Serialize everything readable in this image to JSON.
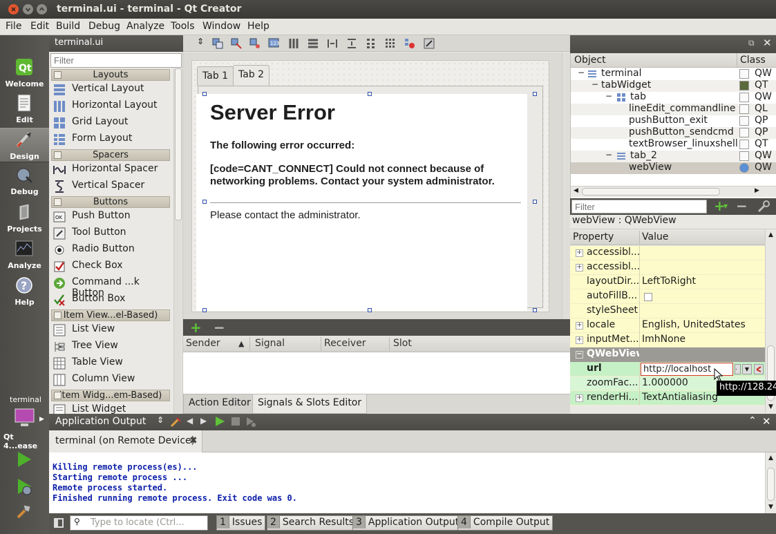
{
  "window": {
    "title": "terminal.ui - terminal - Qt Creator"
  },
  "menu": [
    "File",
    "Edit",
    "Build",
    "Debug",
    "Analyze",
    "Tools",
    "Window",
    "Help"
  ],
  "modes": [
    {
      "label": "Welcome",
      "icon": "qt-logo-icon"
    },
    {
      "label": "Edit",
      "icon": "edit-document-icon"
    },
    {
      "label": "Design",
      "icon": "design-brush-icon"
    },
    {
      "label": "Debug",
      "icon": "debug-bug-icon"
    },
    {
      "label": "Projects",
      "icon": "projects-folder-icon"
    },
    {
      "label": "Analyze",
      "icon": "analyze-chart-icon"
    },
    {
      "label": "Help",
      "icon": "help-question-icon"
    }
  ],
  "target": {
    "project": "terminal",
    "kit": "Qt 4...ease"
  },
  "widgetbox": {
    "file": "terminal.ui",
    "filter_placeholder": "Filter",
    "categories": {
      "layouts": "Layouts",
      "spacers": "Spacers",
      "buttons": "Buttons",
      "item_views": "Item View...el-Based)",
      "item_widgets": "Item Widg...em-Based)"
    },
    "layouts": [
      "Vertical Layout",
      "Horizontal Layout",
      "Grid Layout",
      "Form Layout"
    ],
    "spacers": [
      "Horizontal Spacer",
      "Vertical Spacer"
    ],
    "buttons": [
      "Push Button",
      "Tool Button",
      "Radio Button",
      "Check Box",
      "Command ...k Button",
      "Button Box"
    ],
    "item_views": [
      "List View",
      "Tree View",
      "Table View",
      "Column View"
    ],
    "item_widgets": [
      "List Widget"
    ]
  },
  "form": {
    "tabs": [
      "Tab 1",
      "Tab 2"
    ],
    "webview": {
      "heading": "Server Error",
      "subheading": "The following error occurred:",
      "error_line1": "[code=CANT_CONNECT] Could not connect because of",
      "error_line2": "networking problems. Contact your system administrator.",
      "contact": "Please contact the administrator."
    }
  },
  "signals_slots": {
    "columns": [
      "Sender",
      "Signal",
      "Receiver",
      "Slot"
    ],
    "sort_arrow": "▲"
  },
  "editor_tabs": [
    "Action Editor",
    "Signals & Slots Editor"
  ],
  "object_inspector": {
    "columns": [
      "Object",
      "Class"
    ],
    "rows": [
      {
        "name": "terminal",
        "class": "QW"
      },
      {
        "name": "tabWidget",
        "class": "QT"
      },
      {
        "name": "tab",
        "class": "QW"
      },
      {
        "name": "lineEdit_commandline",
        "class": "QL"
      },
      {
        "name": "pushButton_exit",
        "class": "QP"
      },
      {
        "name": "pushButton_sendcmd",
        "class": "QP"
      },
      {
        "name": "textBrowser_linuxshell",
        "class": "QT"
      },
      {
        "name": "tab_2",
        "class": "QW"
      },
      {
        "name": "webView",
        "class": "QW"
      }
    ]
  },
  "property_editor": {
    "filter_placeholder": "Filter",
    "class_label": "webView : QWebView",
    "columns": [
      "Property",
      "Value"
    ],
    "section": "QWebView",
    "rows": [
      {
        "name": "accessibl...",
        "value": ""
      },
      {
        "name": "accessibl...",
        "value": ""
      },
      {
        "name": "layoutDir...",
        "value": "LeftToRight"
      },
      {
        "name": "autoFillB...",
        "value": ""
      },
      {
        "name": "styleSheet",
        "value": ""
      },
      {
        "name": "locale",
        "value": "English, UnitedStates"
      },
      {
        "name": "inputMet...",
        "value": "ImhNone"
      }
    ],
    "web_rows": [
      {
        "name": "url",
        "value": "http://localhost"
      },
      {
        "name": "zoomFac...",
        "value": "1.000000"
      },
      {
        "name": "renderHi...",
        "value": "TextAntialiasing"
      }
    ],
    "url_tooltip": "http://128.24"
  },
  "output": {
    "title": "Application Output",
    "tab": "terminal (on Remote Device)",
    "lines": [
      "Killing remote process(es)...",
      "Starting remote process ...",
      "Remote process started.",
      "Finished running remote process. Exit code was 0."
    ]
  },
  "status": {
    "locate_placeholder": "Type to locate (Ctrl...",
    "panes": [
      {
        "num": "1",
        "label": "Issues"
      },
      {
        "num": "2",
        "label": "Search Results"
      },
      {
        "num": "3",
        "label": "Application Output"
      },
      {
        "num": "4",
        "label": "Compile Output"
      }
    ]
  }
}
